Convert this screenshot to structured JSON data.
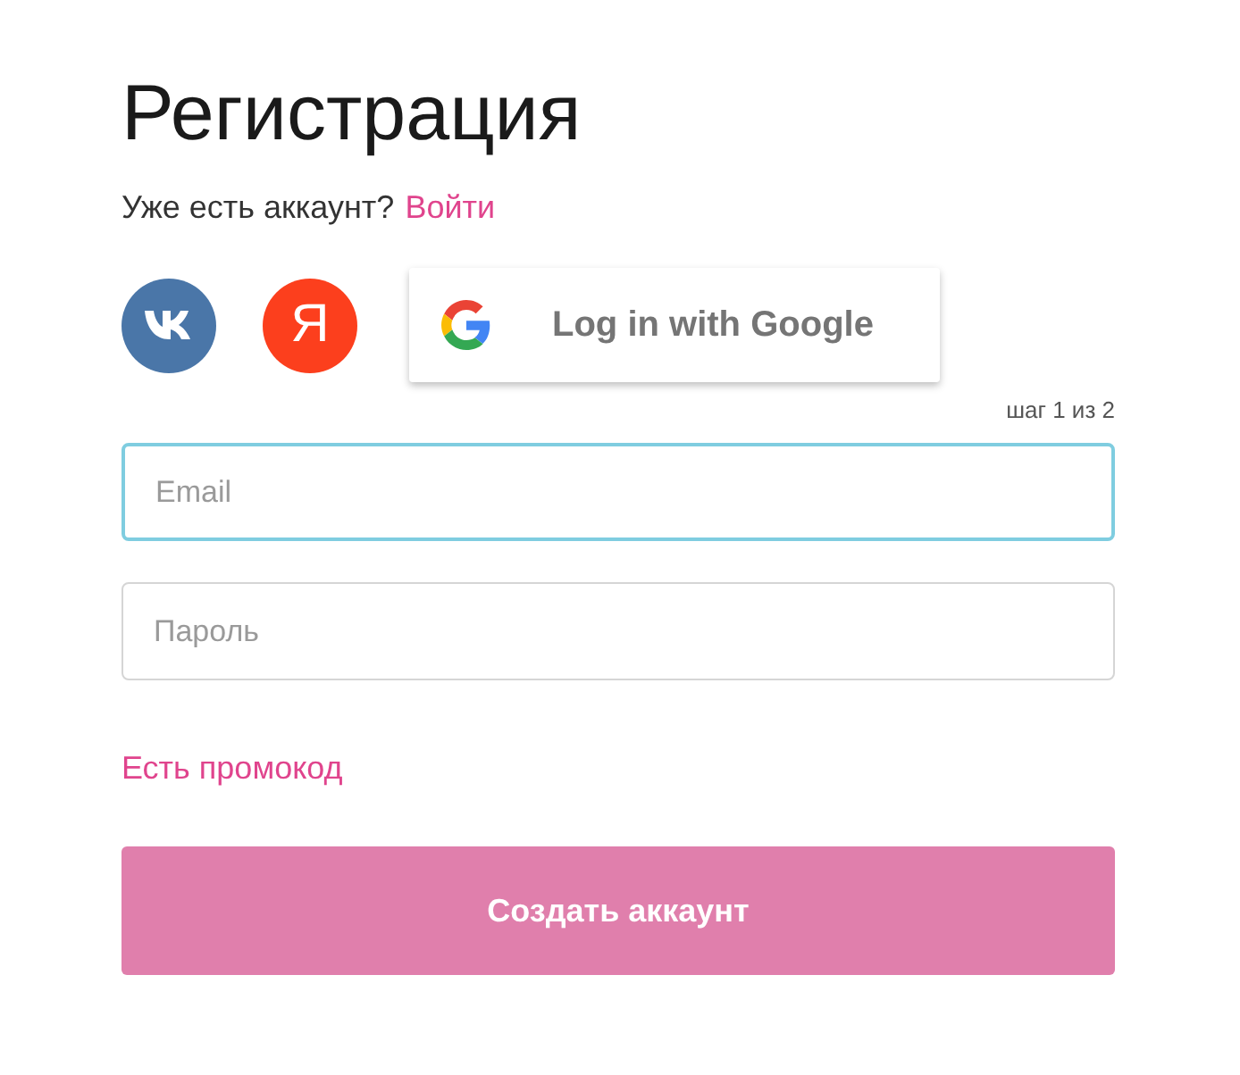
{
  "title": "Регистрация",
  "login_prompt": {
    "text": "Уже есть аккаунт?",
    "link": "Войти"
  },
  "social_buttons": [
    {
      "kind": "vk"
    },
    {
      "kind": "yandex",
      "letter": "Я"
    },
    {
      "kind": "google",
      "label": "Log in with Google"
    }
  ],
  "step": "шаг 1 из 2",
  "fields": [
    {
      "placeholder": "Email",
      "focused": true
    },
    {
      "placeholder": "Пароль",
      "focused": false
    }
  ],
  "promo_link": "Есть промокод",
  "submit": {
    "label": "Создать аккаунт"
  }
}
